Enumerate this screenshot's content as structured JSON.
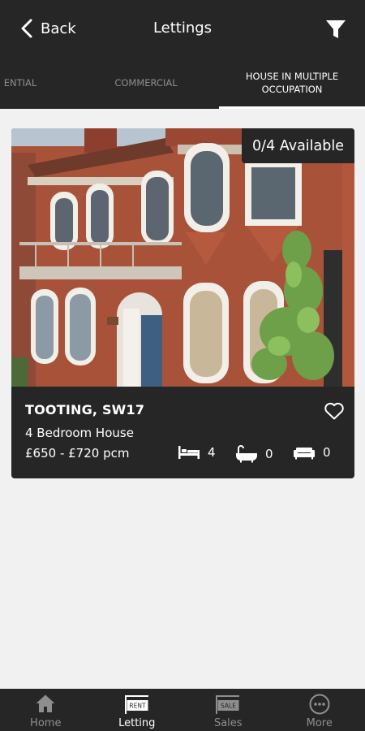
{
  "header": {
    "back_label": "Back",
    "title": "Lettings"
  },
  "tabs": [
    {
      "label": "ENTIAL"
    },
    {
      "label": "COMMERCIAL"
    },
    {
      "label": "HOUSE IN MULTIPLE OCCUPATION"
    }
  ],
  "listing": {
    "availability": "0/4 Available",
    "location": "TOOTING, SW17",
    "property_type": "4 Bedroom House",
    "price": "£650 - £720 pcm",
    "bedrooms": "4",
    "bathrooms": "0",
    "receptions": "0"
  },
  "bottom_nav": [
    {
      "label": "Home",
      "icon": "home-icon"
    },
    {
      "label": "Letting",
      "icon": "rent-sign-icon",
      "sign": "RENT"
    },
    {
      "label": "Sales",
      "icon": "sale-sign-icon",
      "sign": "SALE"
    },
    {
      "label": "More",
      "icon": "more-icon"
    }
  ],
  "colors": {
    "bar": "#262626",
    "background": "#f1f1f1",
    "inactive": "#8e8e8e"
  }
}
